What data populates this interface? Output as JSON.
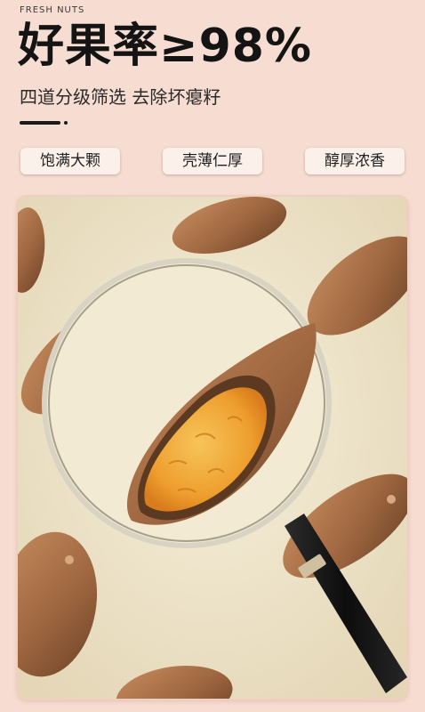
{
  "header": {
    "eyebrow": "FRESH NUTS",
    "headline": "好果率≥98%",
    "subtitle": "四道分级筛选 去除坏瘪籽"
  },
  "tags": [
    {
      "label": "饱满大颗"
    },
    {
      "label": "壳薄仁厚"
    },
    {
      "label": "醇厚浓香"
    }
  ],
  "colors": {
    "page_background": "#f7ddd1",
    "photo_background": "#efe5cc",
    "shell": "#a8704a",
    "kernel": "#f0a93a",
    "magnifier_handle": "#1a1a1a",
    "magnifier_ring": "#d9d3c4"
  },
  "photo": {
    "subject": "magnifying-glass-over-pecans-icon"
  }
}
